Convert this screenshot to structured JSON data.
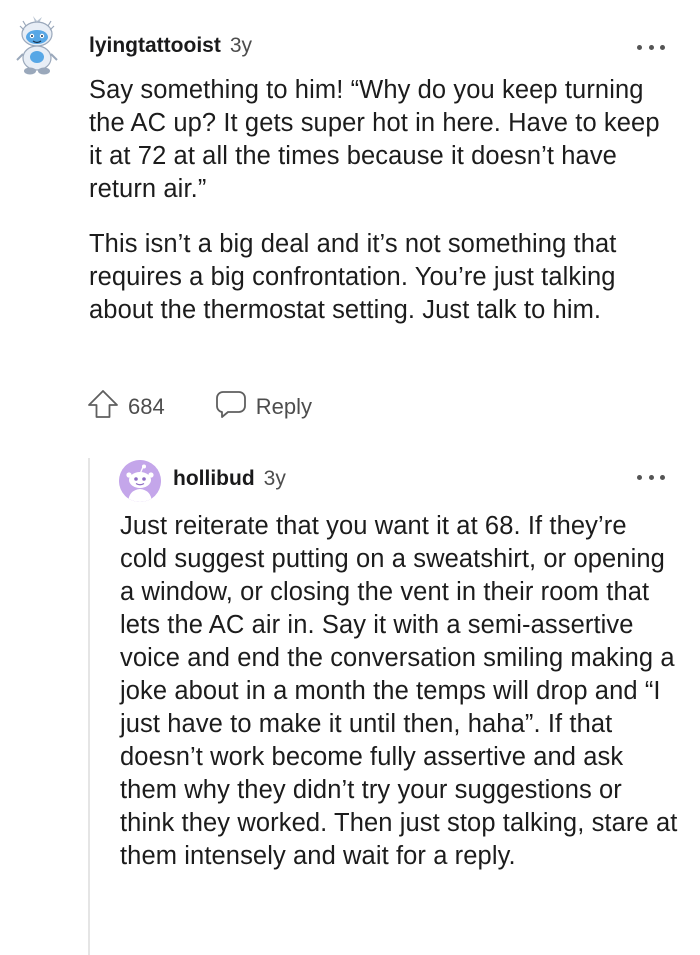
{
  "comments": [
    {
      "username": "lyingtattooist",
      "age": "3y",
      "avatar_icon": "yeti-snoo-avatar-icon",
      "paragraphs": [
        "Say something to him! “Why do you keep turning the AC up? It gets super hot in here. Have to keep it at 72 at all the times because it doesn’t have return air.”",
        "This isn’t a big deal and it’s not something that requires a big confrontation. You’re just talking about the thermostat setting. Just talk to him."
      ],
      "votes": "684",
      "reply_label": "Reply",
      "vote_icon": "upvote-arrow-icon",
      "reply_icon": "speech-bubble-icon",
      "more_icon": "more-options-icon"
    },
    {
      "username": "hollibud",
      "age": "3y",
      "avatar_icon": "default-snoo-avatar-icon",
      "avatar_color": "#c4a6ea",
      "paragraphs": [
        "Just reiterate that you want it at 68. If they’re cold suggest putting on a sweatshirt, or opening a window, or closing the vent in their room that lets the AC air in. Say it with a semi-assertive voice and end the conversation smiling making a joke about in a month the temps will drop and “I just have to make it until then, haha”. If that doesn’t work become fully assertive and ask them why they didn’t try your suggestions or think they worked. Then just stop talking, stare at them intensely and wait for a reply."
      ],
      "more_icon": "more-options-icon"
    }
  ]
}
